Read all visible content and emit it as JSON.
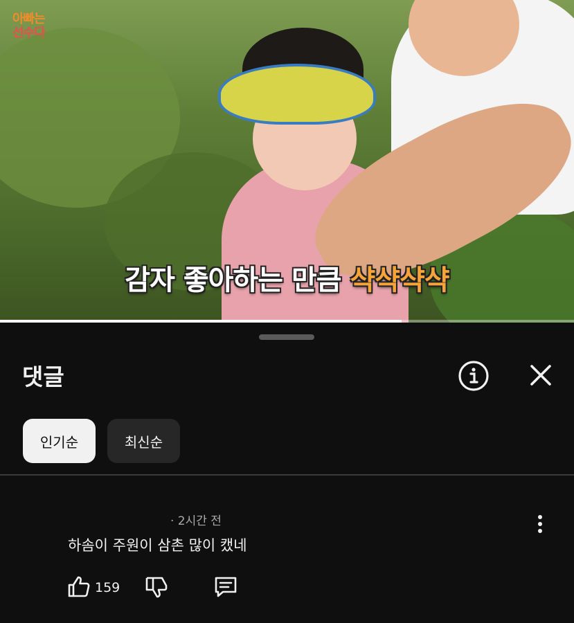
{
  "video": {
    "logo_line1": "아빠는",
    "logo_line2": "선수다",
    "subtitle_main": "감자 좋아하는 만큼",
    "subtitle_accent": "샥샥샥샥",
    "progress": 0.7
  },
  "panel": {
    "title": "댓글",
    "info_icon": "info-icon",
    "close_icon": "close-icon"
  },
  "sort": {
    "popular": "인기순",
    "newest": "최신순",
    "selected": "인기순"
  },
  "comment": {
    "time": "· 2시간 전",
    "text": "하솜이 주원이 삼촌 많이 캤네",
    "likes": "159",
    "icons": [
      "thumbs-up-icon",
      "thumbs-down-icon",
      "reply-icon",
      "more-vertical-icon"
    ]
  },
  "colors": {
    "background": "#0f0f0f",
    "chip_selected": "#f1f1f1",
    "chip_unselected": "#272727",
    "subtitle_accent": "#f6a33a"
  }
}
